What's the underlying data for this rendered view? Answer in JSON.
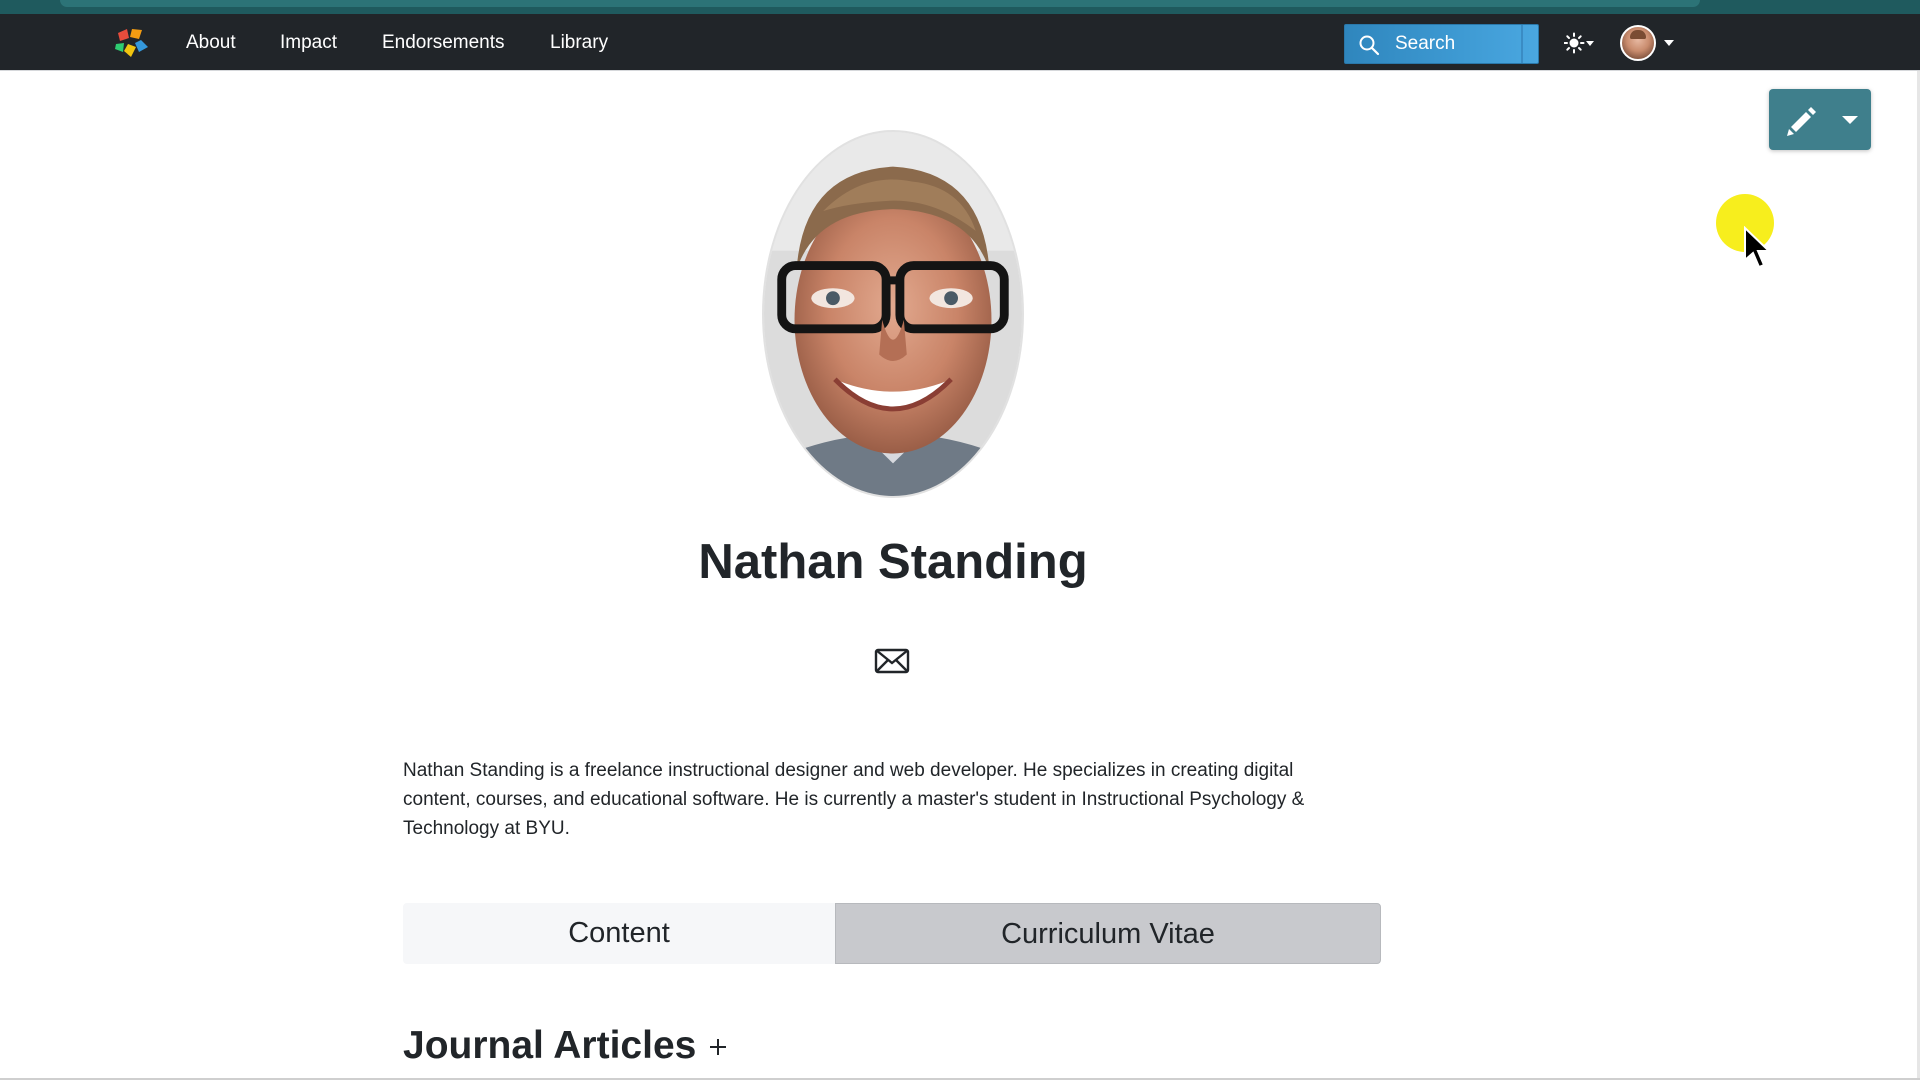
{
  "navbar": {
    "links": [
      "About",
      "Impact",
      "Endorsements",
      "Library"
    ],
    "search": {
      "placeholder": "Search",
      "value": ""
    },
    "background": "#212529"
  },
  "toolbar": {
    "edit_icon": "pencil-icon",
    "accent": "#3f7f8c"
  },
  "profile": {
    "name": "Nathan Standing",
    "bio": "Nathan Standing is a freelance instructional designer and web developer. He specializes in creating digital content, courses, and educational software. He is currently a master's student in Instructional Psychology & Technology at BYU."
  },
  "tabs": [
    {
      "label": "Content",
      "active": false
    },
    {
      "label": "Curriculum Vitae",
      "active": true
    }
  ],
  "section": {
    "title": "Journal Articles"
  },
  "colors": {
    "search_accent": "#3e9ad3",
    "cursor_highlight": "#f7ee1d",
    "top_strip": "#1f5a5e"
  }
}
